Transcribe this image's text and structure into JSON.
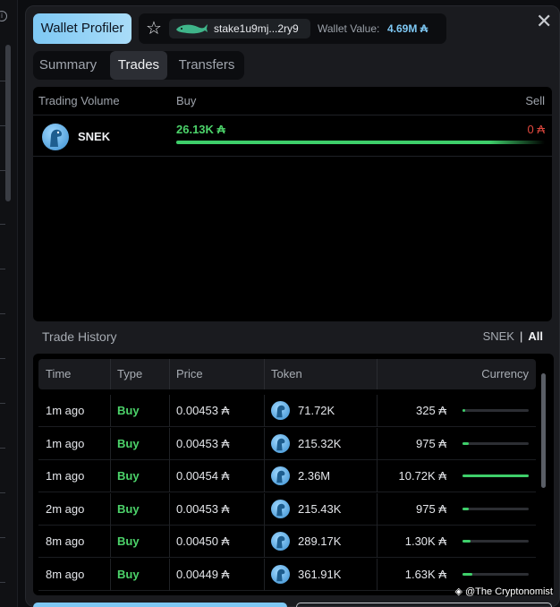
{
  "left_rail": {
    "info_glyph": "i"
  },
  "header": {
    "profiler_button": "Wallet Profiler",
    "star_icon": "star-icon",
    "wallet_address": "stake1u9mj...2ry9",
    "wallet_value_label": "Wallet Value:",
    "wallet_value": "4.69M ₳",
    "close_icon": "close-icon"
  },
  "tabs": [
    {
      "label": "Summary",
      "active": false
    },
    {
      "label": "Trades",
      "active": true
    },
    {
      "label": "Transfers",
      "active": false
    }
  ],
  "volume": {
    "columns": {
      "token": "Trading Volume",
      "buy": "Buy",
      "sell": "Sell"
    },
    "rows": [
      {
        "token": "SNEK",
        "buy": "26.13K ₳",
        "sell": "0 ₳",
        "buy_share": 1.0
      }
    ]
  },
  "history": {
    "title": "Trade History",
    "filter": {
      "option1": "SNEK",
      "separator": "|",
      "option2": "All",
      "selected": "All"
    },
    "columns": {
      "time": "Time",
      "type": "Type",
      "price": "Price",
      "token": "Token",
      "currency": "Currency"
    },
    "rows": [
      {
        "time": "1m ago",
        "type": "Buy",
        "price": "0.00453 ₳",
        "token_amount": "71.72K",
        "currency": "325 ₳",
        "currency_share": 0.03
      },
      {
        "time": "1m ago",
        "type": "Buy",
        "price": "0.00453 ₳",
        "token_amount": "215.32K",
        "currency": "975 ₳",
        "currency_share": 0.09
      },
      {
        "time": "1m ago",
        "type": "Buy",
        "price": "0.00454 ₳",
        "token_amount": "2.36M",
        "currency": "10.72K ₳",
        "currency_share": 1.0
      },
      {
        "time": "2m ago",
        "type": "Buy",
        "price": "0.00453 ₳",
        "token_amount": "215.43K",
        "currency": "975 ₳",
        "currency_share": 0.09
      },
      {
        "time": "8m ago",
        "type": "Buy",
        "price": "0.00450 ₳",
        "token_amount": "289.17K",
        "currency": "1.30K ₳",
        "currency_share": 0.12
      },
      {
        "time": "8m ago",
        "type": "Buy",
        "price": "0.00449 ₳",
        "token_amount": "361.91K",
        "currency": "1.63K ₳",
        "currency_share": 0.15
      }
    ]
  },
  "watermark": "@The Cryptonomist",
  "colors": {
    "accent": "#7ec8f4",
    "buy": "#4cd36a",
    "sell": "#e0483e"
  }
}
